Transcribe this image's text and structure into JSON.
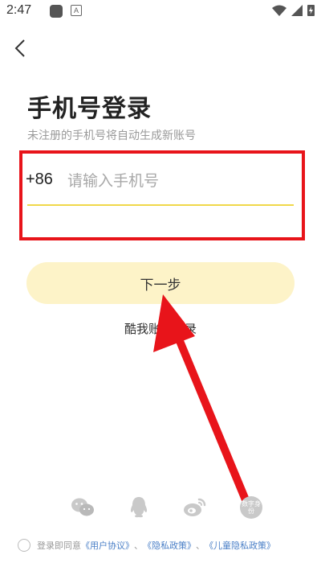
{
  "status_bar": {
    "time": "2:47",
    "notif_letter": "A"
  },
  "header": {
    "title": "手机号登录",
    "subtitle": "未注册的手机号将自动生成新账号"
  },
  "phone": {
    "prefix": "+86",
    "placeholder": "请输入手机号",
    "value": ""
  },
  "next_button": {
    "label": "下一步"
  },
  "alt_login": {
    "label": "酷我账号登录"
  },
  "social": {
    "items": [
      "wechat-icon",
      "qq-icon",
      "weibo-icon",
      "digital-id-icon"
    ],
    "digital_id_label": "数字身份"
  },
  "agreement": {
    "prefix": "登录即同意",
    "user_agreement": "《用户协议》",
    "sep1": "、",
    "privacy_policy": "《隐私政策》",
    "sep2": "、",
    "child_privacy": "《儿童隐私政策》"
  },
  "colors": {
    "highlight_box": "#e8141a",
    "button_bg": "#fdf3c8",
    "underline": "#f0d84a",
    "link": "#4a7fc7"
  }
}
